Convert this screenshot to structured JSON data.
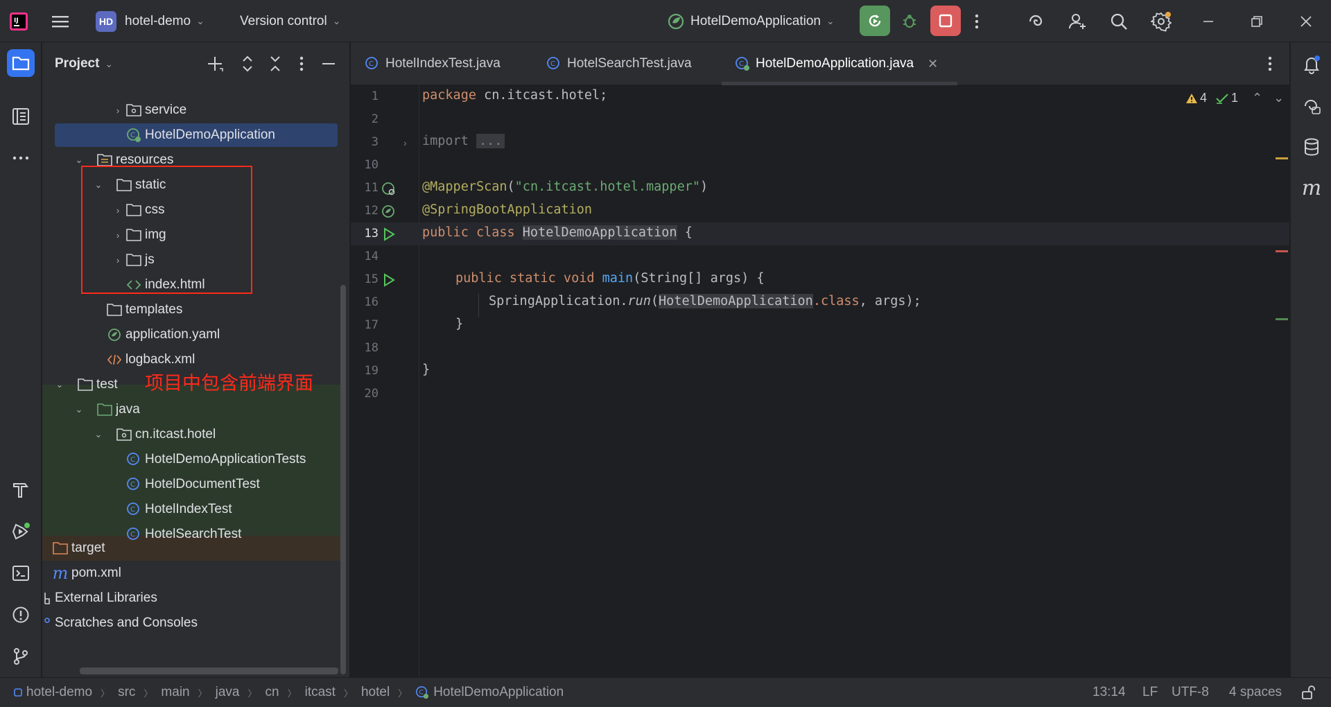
{
  "titlebar": {
    "project_badge": "HD",
    "project_name": "hotel-demo",
    "vcs_label": "Version control",
    "run_config": "HotelDemoApplication"
  },
  "project_panel": {
    "title": "Project",
    "tree": [
      {
        "label": "service",
        "type": "package",
        "depth": 3,
        "expanded": false
      },
      {
        "label": "HotelDemoApplication",
        "type": "spring-class",
        "depth": 3,
        "selected": true
      },
      {
        "label": "resources",
        "type": "resource-folder",
        "depth": 2,
        "expanded": true
      },
      {
        "label": "static",
        "type": "folder",
        "depth": 3,
        "expanded": true
      },
      {
        "label": "css",
        "type": "folder",
        "depth": 4,
        "expanded": false
      },
      {
        "label": "img",
        "type": "folder",
        "depth": 4,
        "expanded": false
      },
      {
        "label": "js",
        "type": "folder",
        "depth": 4,
        "expanded": false
      },
      {
        "label": "index.html",
        "type": "html",
        "depth": 4
      },
      {
        "label": "templates",
        "type": "folder",
        "depth": 3
      },
      {
        "label": "application.yaml",
        "type": "yaml",
        "depth": 3
      },
      {
        "label": "logback.xml",
        "type": "xml",
        "depth": 3
      },
      {
        "label": "test",
        "type": "folder",
        "depth": 1,
        "expanded": true
      },
      {
        "label": "java",
        "type": "test-folder",
        "depth": 2,
        "expanded": true
      },
      {
        "label": "cn.itcast.hotel",
        "type": "package",
        "depth": 3,
        "expanded": true
      },
      {
        "label": "HotelDemoApplicationTests",
        "type": "class",
        "depth": 4
      },
      {
        "label": "HotelDocumentTest",
        "type": "class",
        "depth": 4
      },
      {
        "label": "HotelIndexTest",
        "type": "class",
        "depth": 4
      },
      {
        "label": "HotelSearchTest",
        "type": "class",
        "depth": 4
      },
      {
        "label": "target",
        "type": "excluded-folder",
        "depth": 0
      },
      {
        "label": "pom.xml",
        "type": "maven",
        "depth": 0
      },
      {
        "label": "External Libraries",
        "type": "libraries",
        "depth": 0
      },
      {
        "label": "Scratches and Consoles",
        "type": "scratches",
        "depth": 0
      }
    ],
    "annotation_text": "项目中包含前端界面"
  },
  "tabs": [
    {
      "label": "HotelIndexTest.java",
      "active": false
    },
    {
      "label": "HotelSearchTest.java",
      "active": false
    },
    {
      "label": "HotelDemoApplication.java",
      "active": true
    }
  ],
  "editor": {
    "inspections": {
      "warnings": "4",
      "ok": "1"
    },
    "line_numbers": [
      "1",
      "2",
      "3",
      "10",
      "11",
      "12",
      "13",
      "14",
      "15",
      "16",
      "17",
      "18",
      "19",
      "20"
    ],
    "code": {
      "l1_kw": "package",
      "l1_rest": " cn.itcast.hotel;",
      "l3_kw": "import",
      "l3_fold": "...",
      "l11_ann": "@MapperScan",
      "l11_p1": "(",
      "l11_str": "\"cn.itcast.hotel.mapper\"",
      "l11_p2": ")",
      "l12_ann": "@SpringBootApplication",
      "l13_kw": "public class ",
      "l13_cls": "HotelDemoApplication",
      "l13_rest": " {",
      "l15_kw": "public static void ",
      "l15_fn": "main",
      "l15_rest": "(String[] args) {",
      "l16_a": "SpringApplication.",
      "l16_fn": "run",
      "l16_p": "(",
      "l16_cls": "HotelDemoApplication",
      "l16_kw": ".class",
      "l16_rest": ", args);",
      "l17": "}",
      "l19": "}"
    }
  },
  "statusbar": {
    "breadcrumbs": [
      "hotel-demo",
      "src",
      "main",
      "java",
      "cn",
      "itcast",
      "hotel",
      "HotelDemoApplication"
    ],
    "position": "13:14",
    "line_sep": "LF",
    "encoding": "UTF-8",
    "indent": "4 spaces"
  },
  "colors": {
    "accent": "#3574f0",
    "run_green": "#57965c",
    "stop_red": "#db5c5c",
    "annotation_red": "#ff2a1a"
  }
}
